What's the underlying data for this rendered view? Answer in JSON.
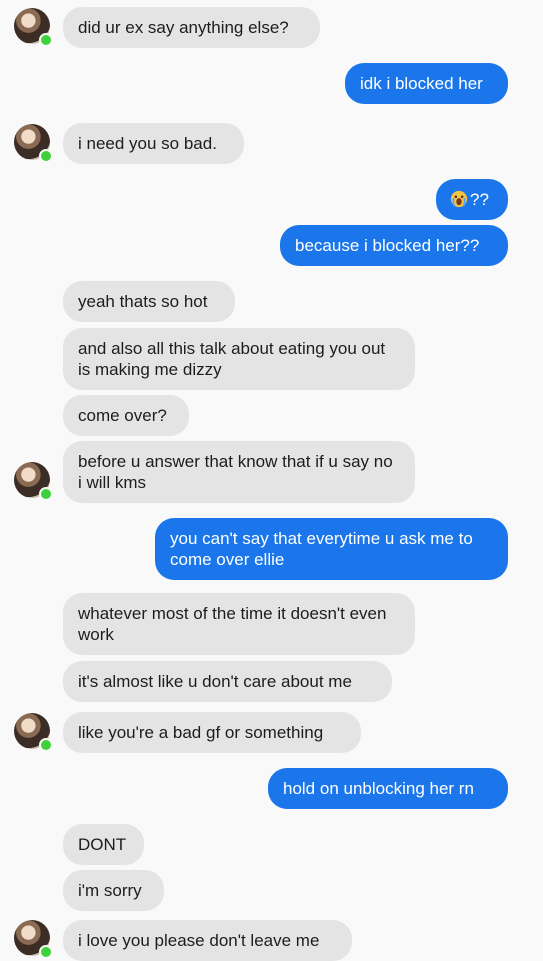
{
  "messages": [
    {
      "side": "in",
      "text": "did ur ex say anything else?"
    },
    {
      "side": "out",
      "text": "idk i blocked her"
    },
    {
      "side": "in",
      "text": "i need you so bad."
    },
    {
      "side": "out",
      "emoji": "face-screaming-crying-emoji",
      "text": "??"
    },
    {
      "side": "out",
      "text": "because i blocked her??"
    },
    {
      "side": "in",
      "text": "yeah thats so hot"
    },
    {
      "side": "in",
      "text": "and also all this talk about eating you out is making me dizzy"
    },
    {
      "side": "in",
      "text": "come over?"
    },
    {
      "side": "in",
      "text": "before u answer that know that if u say no i will kms"
    },
    {
      "side": "out",
      "text": "you can't say that everytime u ask me to come over ellie"
    },
    {
      "side": "in",
      "text": "whatever most of the time it doesn't even work"
    },
    {
      "side": "in",
      "text": "it's almost like u don't care about me"
    },
    {
      "side": "in",
      "text": "like you're a bad gf or something"
    },
    {
      "side": "out",
      "text": "hold on unblocking her rn"
    },
    {
      "side": "in",
      "text": "DONT"
    },
    {
      "side": "in",
      "text": "i'm sorry"
    },
    {
      "side": "in",
      "text": "i love you please don't leave me"
    }
  ],
  "colors": {
    "incoming_bubble": "#e4e4e4",
    "outgoing_bubble": "#1a76ea",
    "online_dot": "#3ed13c",
    "background": "#f9f9f9"
  },
  "icons": {
    "avatar": "contact-avatar",
    "online": "online-status-dot"
  }
}
